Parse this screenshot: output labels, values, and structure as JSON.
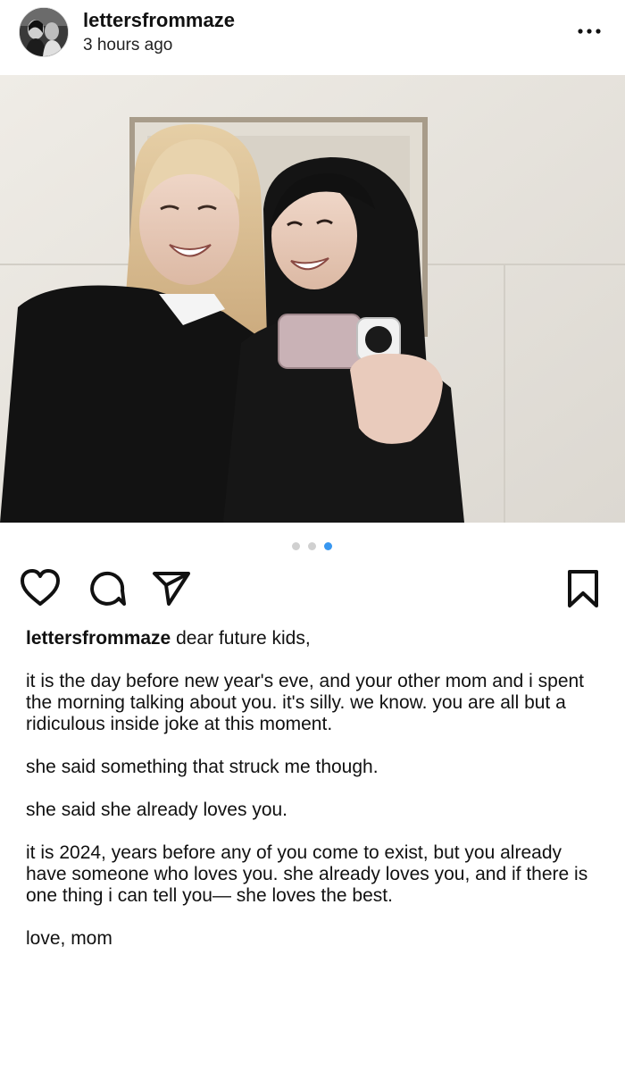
{
  "post": {
    "username": "lettersfrommaze",
    "timestamp": "3 hours ago",
    "more_icon": "more-horizontal-icon"
  },
  "carousel": {
    "total": 3,
    "active_index": 2,
    "active_color": "#3897f0",
    "inactive_color": "#d0d0d0"
  },
  "actions": {
    "like_icon": "heart-icon",
    "comment_icon": "comment-icon",
    "share_icon": "send-icon",
    "save_icon": "bookmark-icon"
  },
  "caption": {
    "username": "lettersfrommaze",
    "opening": "dear future kids,",
    "p1": "it is the day before new year's eve, and your other mom and i spent the morning talking about you. it's silly. we know. you are all but a ridiculous inside joke at this moment.",
    "p2": "she said something that struck me though.",
    "p3": "she said she already loves you.",
    "p4": "it is 2024, years before any of you come to exist, but you already have someone who loves you. she already loves you, and if there is one thing i can tell you— she loves the best.",
    "p5": "love, mom"
  }
}
